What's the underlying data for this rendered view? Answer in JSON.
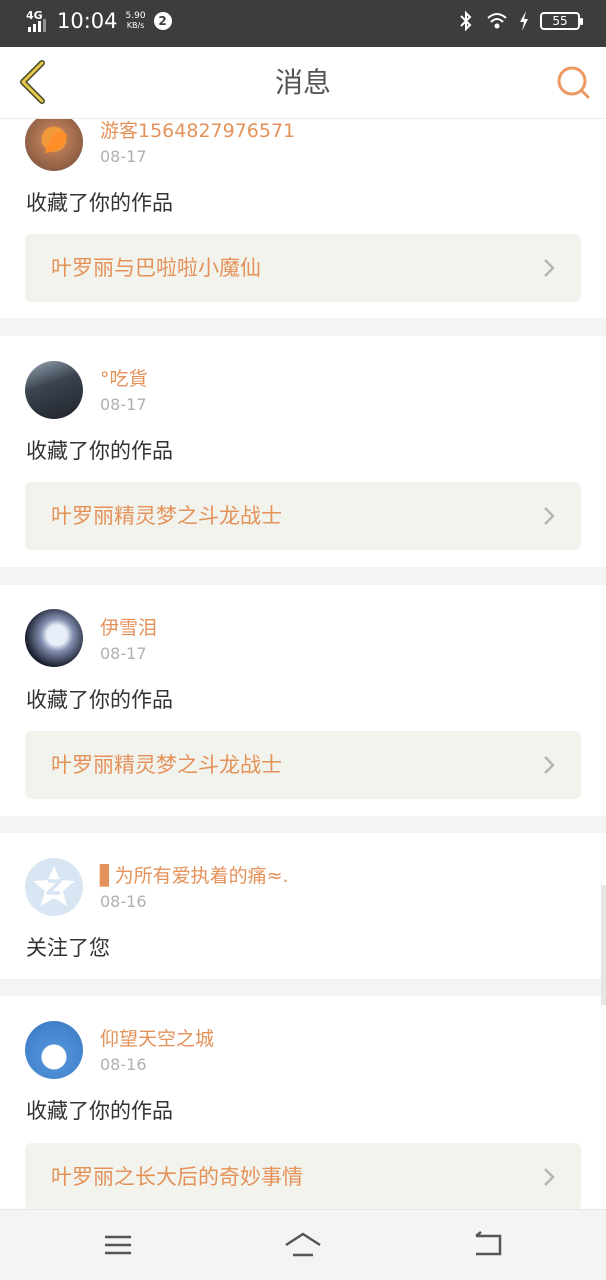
{
  "status_bar": {
    "network": "4G",
    "time": "10:04",
    "speed_value": "5.90",
    "speed_unit": "KB/s",
    "notification_count": "2",
    "battery": "55",
    "icons": [
      "bluetooth-icon",
      "wifi-icon",
      "charging-icon",
      "battery-icon"
    ]
  },
  "header": {
    "title": "消息",
    "back_icon": "chevron-left-icon",
    "search_icon": "search-icon"
  },
  "messages": [
    {
      "user": "游客1564827976571",
      "date": "08-17",
      "action": "收藏了你的作品",
      "work": "叶罗丽与巴啦啦小魔仙",
      "avatar": "avatar-orange-leaf"
    },
    {
      "user": "°吃貨",
      "date": "08-17",
      "action": "收藏了你的作品",
      "work": "叶罗丽精灵梦之斗龙战士",
      "avatar": "avatar-dark-hair"
    },
    {
      "user": "伊雪泪",
      "date": "08-17",
      "action": "收藏了你的作品",
      "work": "叶罗丽精灵梦之斗龙战士",
      "avatar": "avatar-anime-girl"
    },
    {
      "user": "▋为所有爱执着的痛≈.",
      "date": "08-16",
      "action": "关注了您",
      "work": null,
      "avatar": "avatar-default-z"
    },
    {
      "user": "仰望天空之城",
      "date": "08-16",
      "action": "收藏了你的作品",
      "work": "叶罗丽之长大后的奇妙事情",
      "avatar": "avatar-blue-hair-boy"
    }
  ],
  "colors": {
    "accent": "#e4925a",
    "status_bar_bg": "#3d3d3d",
    "work_card_bg": "#f3f3ed",
    "page_bg": "#f4f4f4"
  },
  "navbar": {
    "icons": [
      "menu-icon",
      "home-icon",
      "back-nav-icon"
    ]
  }
}
